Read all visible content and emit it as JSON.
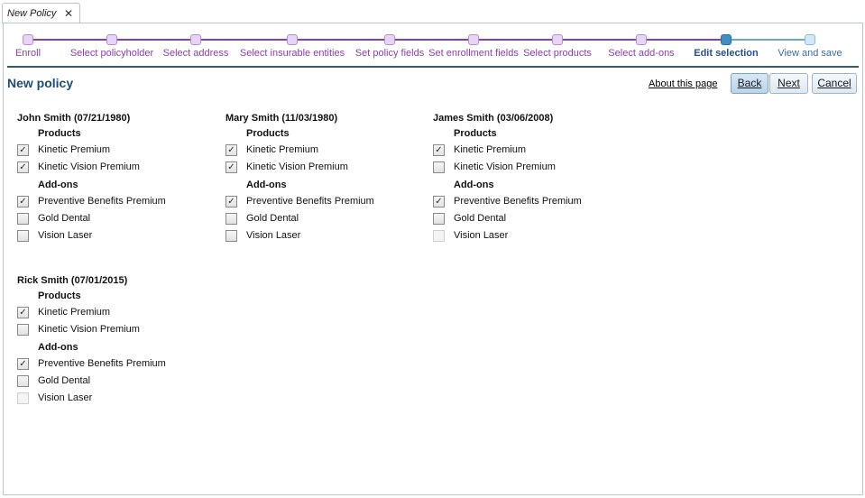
{
  "tab": {
    "title": "New Policy",
    "close": "✕"
  },
  "wizard": {
    "steps": [
      {
        "label": "Enroll",
        "state": "done"
      },
      {
        "label": "Select policyholder",
        "state": "done"
      },
      {
        "label": "Select address",
        "state": "done"
      },
      {
        "label": "Select insurable entities",
        "state": "done"
      },
      {
        "label": "Set policy fields",
        "state": "done"
      },
      {
        "label": "Set enrollment fields",
        "state": "done"
      },
      {
        "label": "Select products",
        "state": "done"
      },
      {
        "label": "Select add-ons",
        "state": "done"
      },
      {
        "label": "Edit selection",
        "state": "active"
      },
      {
        "label": "View and save",
        "state": "future"
      }
    ]
  },
  "header": {
    "title": "New policy",
    "about": "About this page",
    "back": "Back",
    "next": "Next",
    "cancel": "Cancel"
  },
  "section_labels": {
    "products": "Products",
    "addons": "Add-ons"
  },
  "insured": [
    {
      "name": "John Smith (07/21/1980)",
      "products": [
        {
          "label": "Kinetic Premium",
          "checked": true,
          "disabled": false
        },
        {
          "label": "Kinetic Vision Premium",
          "checked": true,
          "disabled": false
        }
      ],
      "addons": [
        {
          "label": "Preventive Benefits Premium",
          "checked": true,
          "disabled": false
        },
        {
          "label": "Gold Dental",
          "checked": false,
          "disabled": false
        },
        {
          "label": "Vision Laser",
          "checked": false,
          "disabled": false
        }
      ]
    },
    {
      "name": "Mary Smith (11/03/1980)",
      "products": [
        {
          "label": "Kinetic Premium",
          "checked": true,
          "disabled": false
        },
        {
          "label": "Kinetic Vision Premium",
          "checked": true,
          "disabled": false
        }
      ],
      "addons": [
        {
          "label": "Preventive Benefits Premium",
          "checked": true,
          "disabled": false
        },
        {
          "label": "Gold Dental",
          "checked": false,
          "disabled": false
        },
        {
          "label": "Vision Laser",
          "checked": false,
          "disabled": false
        }
      ]
    },
    {
      "name": "James Smith (03/06/2008)",
      "products": [
        {
          "label": "Kinetic Premium",
          "checked": true,
          "disabled": false
        },
        {
          "label": "Kinetic Vision Premium",
          "checked": false,
          "disabled": false
        }
      ],
      "addons": [
        {
          "label": "Preventive Benefits Premium",
          "checked": true,
          "disabled": false
        },
        {
          "label": "Gold Dental",
          "checked": false,
          "disabled": false
        },
        {
          "label": "Vision Laser",
          "checked": false,
          "disabled": true
        }
      ]
    },
    {
      "name": "Rick Smith (07/01/2015)",
      "products": [
        {
          "label": "Kinetic Premium",
          "checked": true,
          "disabled": false
        },
        {
          "label": "Kinetic Vision Premium",
          "checked": false,
          "disabled": false
        }
      ],
      "addons": [
        {
          "label": "Preventive Benefits Premium",
          "checked": true,
          "disabled": false
        },
        {
          "label": "Gold Dental",
          "checked": false,
          "disabled": false
        },
        {
          "label": "Vision Laser",
          "checked": false,
          "disabled": true
        }
      ]
    }
  ],
  "colors": {
    "step_done": "#e7d5f5",
    "step_active": "#3e8fc3",
    "step_future": "#d3e7f6",
    "step_label": "#8b3fa9",
    "title": "#1f4c73",
    "header_line": "#2f5d73"
  }
}
